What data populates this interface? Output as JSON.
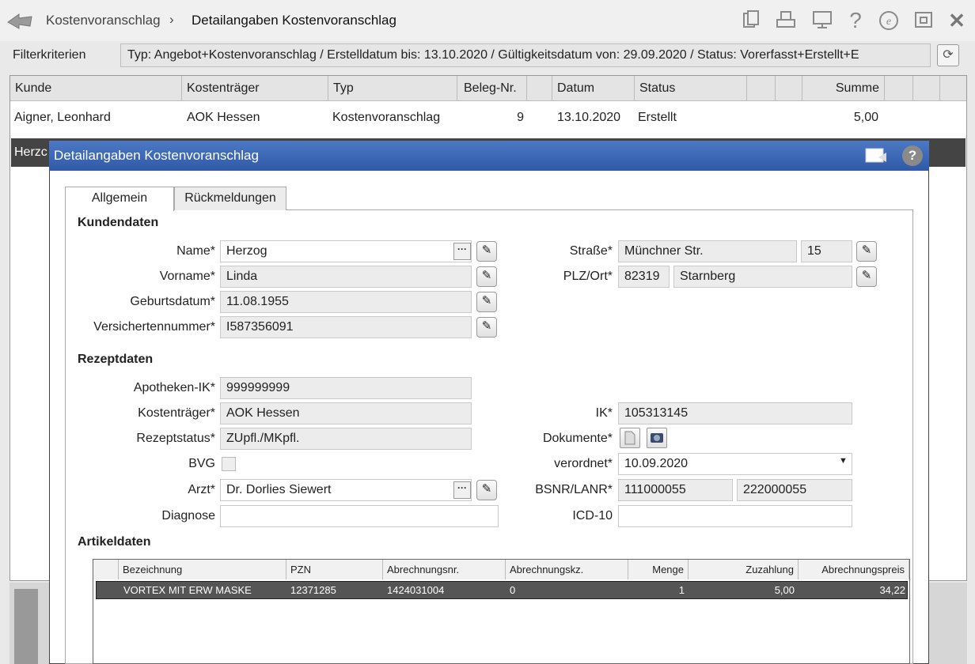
{
  "breadcrumb": {
    "parent": "Kostenvoranschlag",
    "separator": "›",
    "current": "Detailangaben Kostenvoranschlag"
  },
  "toolbar_icons": [
    "copy-icon",
    "print-icon",
    "monitor-icon",
    "help-icon",
    "e-icon",
    "window-icon",
    "close-icon"
  ],
  "filter": {
    "label": "Filterkriterien",
    "value": "Typ: Angebot+Kostenvoranschlag / Erstelldatum bis: 13.10.2020 / Gültigkeitsdatum von: 29.09.2020 / Status: Vorerfasst+Erstellt+E"
  },
  "list": {
    "columns": [
      "Kunde",
      "Kostenträger",
      "Typ",
      "Beleg-Nr.",
      "Datum",
      "Status",
      "Summe"
    ],
    "rows": [
      {
        "kunde": "Aigner, Leonhard",
        "kostentraeger": "AOK Hessen",
        "typ": "Kostenvoranschlag",
        "beleg": "9",
        "datum": "13.10.2020",
        "status": "Erstellt",
        "summe": "5,00"
      }
    ],
    "selected_partial": "Herzc"
  },
  "dialog": {
    "title": "Detailangaben Kostenvoranschlag",
    "tabs": [
      {
        "label": "Allgemein"
      },
      {
        "label": "Rückmeldungen"
      }
    ],
    "kundendaten": {
      "heading": "Kundendaten",
      "name_label": "Name*",
      "name": "Herzog",
      "vorname_label": "Vorname*",
      "vorname": "Linda",
      "geburtsdatum_label": "Geburtsdatum*",
      "geburtsdatum": "11.08.1955",
      "versichertennummer_label": "Versichertennummer*",
      "versichertennummer": "I587356091",
      "strasse_label": "Straße*",
      "strasse": "Münchner Str.",
      "hausnummer": "15",
      "plzort_label": "PLZ/Ort*",
      "plz": "82319",
      "ort": "Starnberg"
    },
    "rezeptdaten": {
      "heading": "Rezeptdaten",
      "apotheken_ik_label": "Apotheken-IK*",
      "apotheken_ik": "999999999",
      "kostentraeger_label": "Kostenträger*",
      "kostentraeger": "AOK Hessen",
      "rezeptstatus_label": "Rezeptstatus*",
      "rezeptstatus": "ZUpfl./MKpfl.",
      "bvg_label": "BVG",
      "arzt_label": "Arzt*",
      "arzt": "Dr. Dorlies Siewert",
      "diagnose_label": "Diagnose",
      "diagnose": "",
      "ik_label": "IK*",
      "ik": "105313145",
      "dokumente_label": "Dokumente*",
      "verordnet_label": "verordnet*",
      "verordnet": "10.09.2020",
      "bsnr_lanr_label": "BSNR/LANR*",
      "bsnr": "111000055",
      "lanr": "222000055",
      "icd10_label": "ICD-10",
      "icd10": ""
    },
    "artikeldaten": {
      "heading": "Artikeldaten",
      "columns": [
        "Bezeichnung",
        "PZN",
        "Abrechnungsnr.",
        "Abrechnungskz.",
        "Menge",
        "Zuzahlung",
        "Abrechnungspreis"
      ],
      "rows": [
        {
          "bezeichnung": "VORTEX MIT ERW MASKE",
          "pzn": "12371285",
          "abrechnungsnr": "1424031004",
          "abrechnungskz": "0",
          "menge": "1",
          "zuzahlung": "5,00",
          "abrechnungspreis": "34,22"
        }
      ]
    }
  }
}
